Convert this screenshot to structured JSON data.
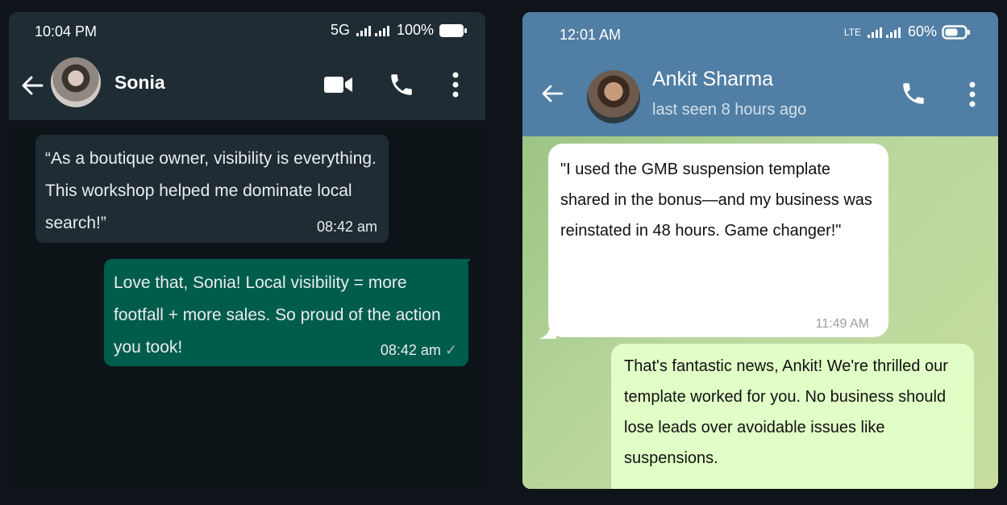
{
  "whatsapp": {
    "status": {
      "time": "10:04 PM",
      "network": "5G",
      "battery": "100%"
    },
    "contact": {
      "name": "Sonia"
    },
    "messages": [
      {
        "direction": "incoming",
        "text": "“As a boutique owner, visibility is everything. This workshop helped me dominate local search!”",
        "time": "08:42 am"
      },
      {
        "direction": "outgoing",
        "text": "Love that, Sonia! Local visibility = more footfall + more sales. So proud of the action you took!",
        "time": "08:42 am",
        "tick": "✓"
      }
    ]
  },
  "telegram": {
    "status": {
      "time": "12:01 AM",
      "network": "LTE",
      "battery": "60%"
    },
    "contact": {
      "name": "Ankit Sharma",
      "last_seen": "last seen 8 hours ago"
    },
    "messages": [
      {
        "direction": "incoming",
        "text": "\"I used the GMB suspension template shared in the bonus—and my business was reinstated in 48 hours. Game changer!\"",
        "time": "11:49 AM"
      },
      {
        "direction": "outgoing",
        "text": "That's fantastic news, Ankit! We're thrilled our template worked for you. No business should lose leads over avoidable issues like suspensions."
      }
    ]
  },
  "icons": {
    "back": "arrow-left-icon",
    "video": "video-camera-icon",
    "call": "phone-icon",
    "menu": "more-vertical-icon",
    "signal": "signal-bars-icon",
    "battery": "battery-icon",
    "read_tick": "checkmark-icon"
  },
  "colors": {
    "wa_header": "#1f2c34",
    "wa_out_bubble": "#005c4b",
    "wa_in_bubble": "#1f2c34",
    "tg_header": "#517ea4",
    "tg_out_bubble": "#e1fec6",
    "tg_in_bubble": "#ffffff"
  }
}
